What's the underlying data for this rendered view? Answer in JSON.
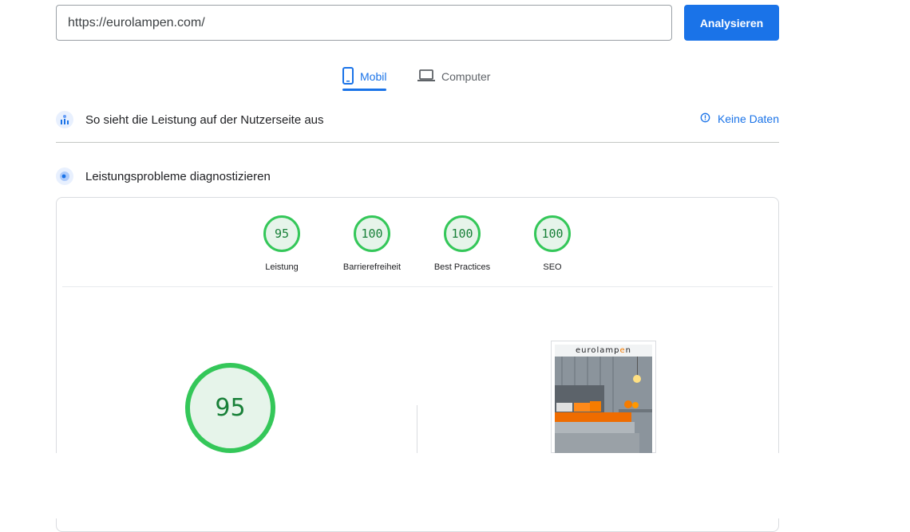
{
  "search": {
    "url": "https://eurolampen.com/",
    "button_label": "Analysieren"
  },
  "tabs": [
    {
      "label": "Mobil",
      "icon": "smartphone-icon",
      "active": true
    },
    {
      "label": "Computer",
      "icon": "laptop-icon",
      "active": false
    }
  ],
  "field_data": {
    "title": "So sieht die Leistung auf der Nutzerseite aus",
    "status": "Keine Daten"
  },
  "lab_data": {
    "title": "Leistungsprobleme diagnostizieren"
  },
  "scores": [
    {
      "label": "Leistung",
      "value": "95"
    },
    {
      "label": "Barrierefreiheit",
      "value": "100"
    },
    {
      "label": "Best Practices",
      "value": "100"
    },
    {
      "label": "SEO",
      "value": "100"
    }
  ],
  "main_score": "95",
  "screenshot": {
    "logo": "eurolampen",
    "logo_accent_color": "#f57c00"
  },
  "colors": {
    "accent": "#1a73e8",
    "pass": "#34c759",
    "pass_text": "#188038"
  }
}
